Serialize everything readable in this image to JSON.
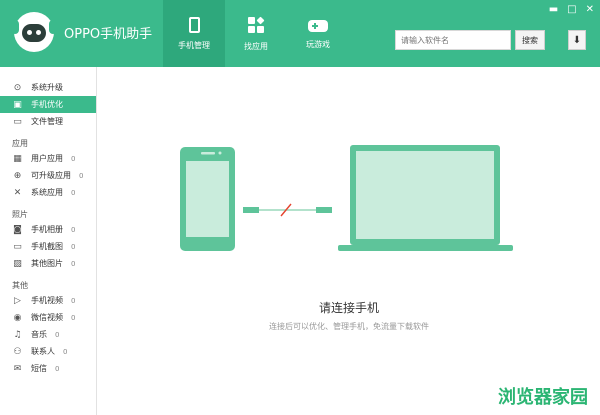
{
  "app": {
    "title": "OPPO手机助手"
  },
  "window_controls": {
    "minimize": "▬",
    "maximize": "□",
    "close": "✕"
  },
  "topnav": [
    {
      "label": "手机管理",
      "icon": "phone-icon",
      "active": true
    },
    {
      "label": "找应用",
      "icon": "apps-icon",
      "active": false
    },
    {
      "label": "玩游戏",
      "icon": "gamepad-icon",
      "active": false
    }
  ],
  "search": {
    "placeholder": "请输入软件名",
    "button": "搜索"
  },
  "download": {
    "icon": "download-icon",
    "glyph": "⬇"
  },
  "sidebar": {
    "top_items": [
      {
        "label": "系统升级",
        "icon": "system-upgrade-icon",
        "glyph": "⊙"
      },
      {
        "label": "手机优化",
        "icon": "phone-optimize-icon",
        "glyph": "▣",
        "active": true
      },
      {
        "label": "文件管理",
        "icon": "folder-icon",
        "glyph": "▭"
      }
    ],
    "sections": [
      {
        "title": "应用",
        "items": [
          {
            "label": "用户应用",
            "count": "0",
            "icon": "user-apps-icon",
            "glyph": "▦"
          },
          {
            "label": "可升级应用",
            "count": "0",
            "icon": "upgradable-apps-icon",
            "glyph": "⊕"
          },
          {
            "label": "系统应用",
            "count": "0",
            "icon": "system-apps-icon",
            "glyph": "✕"
          }
        ]
      },
      {
        "title": "照片",
        "items": [
          {
            "label": "手机相册",
            "count": "0",
            "icon": "camera-icon",
            "glyph": "◙"
          },
          {
            "label": "手机截图",
            "count": "0",
            "icon": "screenshot-icon",
            "glyph": "▭"
          },
          {
            "label": "其他图片",
            "count": "0",
            "icon": "image-icon",
            "glyph": "▨"
          }
        ]
      },
      {
        "title": "其他",
        "items": [
          {
            "label": "手机视频",
            "count": "0",
            "icon": "video-icon",
            "glyph": "▷"
          },
          {
            "label": "微信视频",
            "count": "0",
            "icon": "wechat-video-icon",
            "glyph": "◉"
          },
          {
            "label": "音乐",
            "count": "0",
            "icon": "music-icon",
            "glyph": "♫"
          },
          {
            "label": "联系人",
            "count": "0",
            "icon": "contacts-icon",
            "glyph": "⚇"
          },
          {
            "label": "短信",
            "count": "0",
            "icon": "sms-icon",
            "glyph": "✉"
          }
        ]
      }
    ]
  },
  "main": {
    "title": "请连接手机",
    "subtitle": "连接后可以优化、管理手机，免流量下载软件"
  },
  "watermark": "浏览器家园",
  "colors": {
    "accent": "#3bba8c",
    "accent_dark": "#2ea87c",
    "illustration": "#5ec49a",
    "illustration_light": "#c9ecdc"
  }
}
